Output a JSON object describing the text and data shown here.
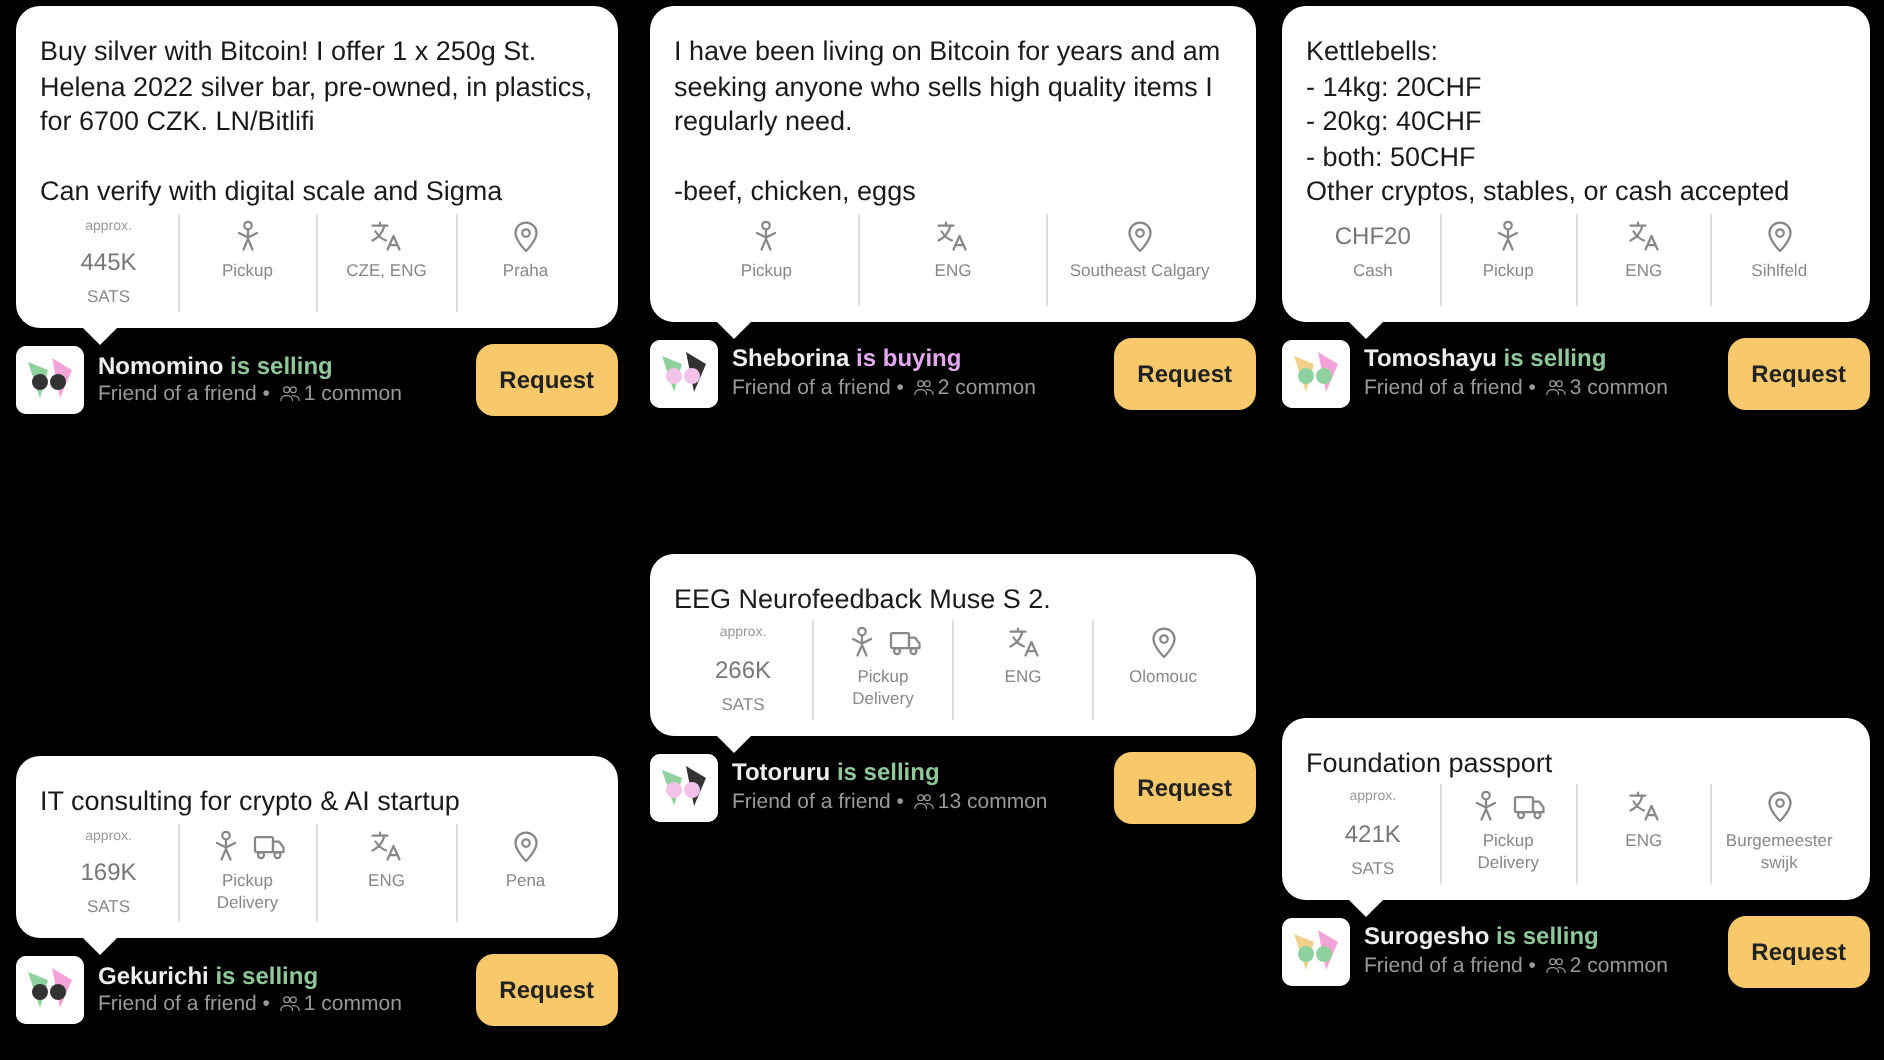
{
  "listings": [
    {
      "description": "Buy silver with Bitcoin! I offer 1 x 250g St. Helena 2022 silver bar, pre-owned, in plastics, for 6700 CZK. LN/Bitlifi\n\nCan verify with digital scale and Sigma",
      "price": {
        "note": "approx.",
        "amount": "445K",
        "unit": "SATS"
      },
      "methods": [
        {
          "kind": "pickup",
          "label": "Pickup"
        }
      ],
      "languages": "CZE, ENG",
      "location": "Praha",
      "seller": {
        "name": "Nomomino",
        "action": "is selling",
        "kind": "selling",
        "relation": "Friend of a friend •",
        "common": "1 common"
      },
      "button": "Request"
    },
    {
      "description": "I have been living on Bitcoin for years and am seeking anyone who sells high quality items I regularly need.\n\n-beef, chicken, eggs",
      "methods": [
        {
          "kind": "pickup",
          "label": "Pickup"
        }
      ],
      "languages": "ENG",
      "location": "Southeast Calgary",
      "seller": {
        "name": "Sheborina",
        "action": "is buying",
        "kind": "buying",
        "relation": "Friend of a friend •",
        "common": "2 common"
      },
      "button": "Request"
    },
    {
      "description": "Kettlebells:\n- 14kg: 20CHF\n- 20kg: 40CHF\n- both: 50CHF\nOther cryptos, stables, or cash accepted",
      "price": {
        "amount": "CHF20",
        "unit": "Cash"
      },
      "methods": [
        {
          "kind": "pickup",
          "label": "Pickup"
        }
      ],
      "languages": "ENG",
      "location": "Sihlfeld",
      "seller": {
        "name": "Tomoshayu",
        "action": "is selling",
        "kind": "selling",
        "relation": "Friend of a friend •",
        "common": "3 common"
      },
      "button": "Request"
    },
    {
      "description": "IT consulting for crypto & AI startup",
      "price": {
        "note": "approx.",
        "amount": "169K",
        "unit": "SATS"
      },
      "methods": [
        {
          "kind": "pickup",
          "label": "Pickup"
        },
        {
          "kind": "delivery",
          "label": "Delivery"
        }
      ],
      "languages": "ENG",
      "location": "Pena",
      "seller": {
        "name": "Gekurichi",
        "action": "is selling",
        "kind": "selling",
        "relation": "Friend of a friend •",
        "common": "1 common"
      },
      "button": "Request"
    },
    {
      "description": "EEG Neurofeedback Muse S 2.",
      "price": {
        "note": "approx.",
        "amount": "266K",
        "unit": "SATS"
      },
      "methods": [
        {
          "kind": "pickup",
          "label": "Pickup"
        },
        {
          "kind": "delivery",
          "label": "Delivery"
        }
      ],
      "languages": "ENG",
      "location": "Olomouc",
      "seller": {
        "name": "Totoruru",
        "action": "is selling",
        "kind": "selling",
        "relation": "Friend of a friend •",
        "common": "13 common"
      },
      "button": "Request"
    },
    {
      "description": "Foundation passport",
      "price": {
        "note": "approx.",
        "amount": "421K",
        "unit": "SATS"
      },
      "methods": [
        {
          "kind": "pickup",
          "label": "Pickup"
        },
        {
          "kind": "delivery",
          "label": "Delivery"
        }
      ],
      "languages": "ENG",
      "location": "Burgemeester swijk",
      "seller": {
        "name": "Surogesho",
        "action": "is selling",
        "kind": "selling",
        "relation": "Friend of a friend •",
        "common": "2 common"
      },
      "button": "Request"
    }
  ]
}
